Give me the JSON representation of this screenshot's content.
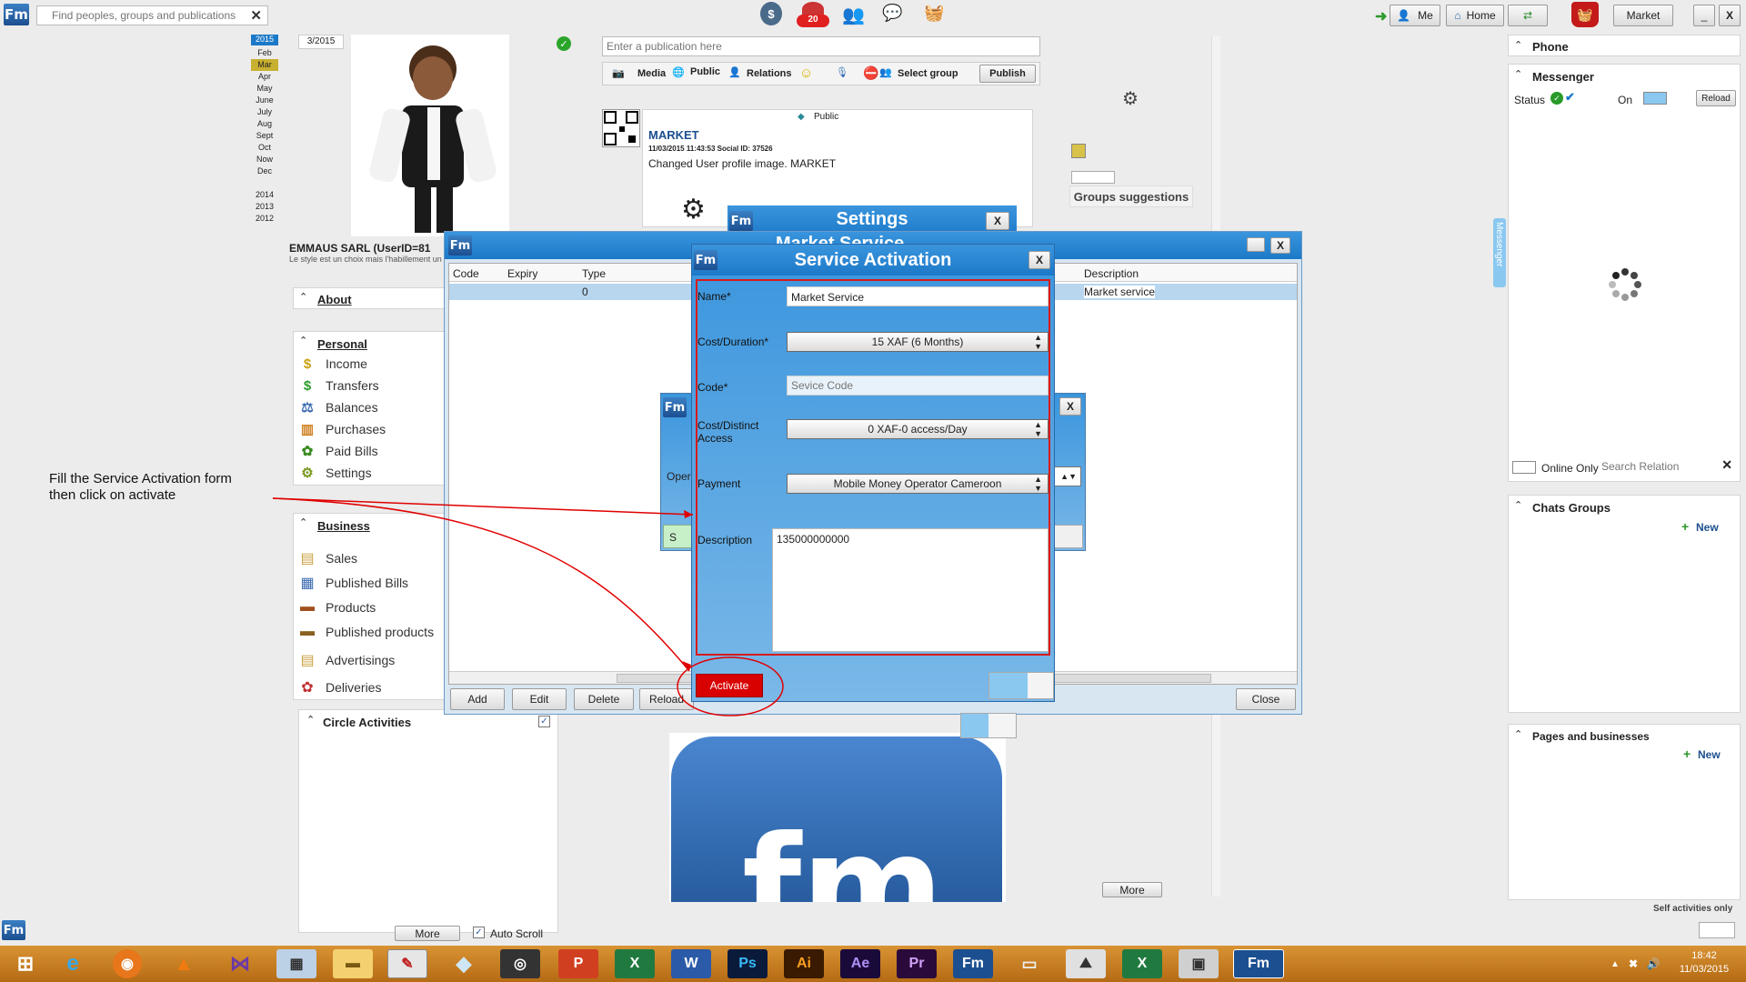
{
  "topbar": {
    "search_placeholder": "Find peoples, groups and publications",
    "notif_count": "20",
    "me_label": "Me",
    "home_label": "Home",
    "market_label": "Market",
    "minimize": "_",
    "close": "X"
  },
  "profile": {
    "year_current": "2015",
    "date_label": "3/2015",
    "months": [
      "Feb",
      "Mar",
      "Apr",
      "May",
      "June",
      "July",
      "Aug",
      "Sept",
      "Oct",
      "Now",
      "Dec"
    ],
    "active_month": "Mar",
    "years": [
      "2014",
      "2013",
      "2012"
    ],
    "name": "EMMAUS SARL (UserID=81",
    "slogan": "Le style est un choix mais l'habillement un"
  },
  "left_menu": {
    "about": "About",
    "personal": "Personal",
    "personal_items": [
      "Income",
      "Transfers",
      "Balances",
      "Purchases",
      "Paid Bills",
      "Settings"
    ],
    "business": "Business",
    "business_items": [
      "Sales",
      "Published Bills",
      "Products",
      "Published products",
      "Advertisings",
      "Deliveries"
    ],
    "circle": "Circle Activities",
    "more": "More",
    "auto_scroll": "Auto Scroll"
  },
  "annotation": {
    "line1": "Fill the Service Activation form",
    "line2": "then click on activate"
  },
  "publication": {
    "placeholder": "Enter a publication here",
    "media": "Media",
    "public": "Public",
    "relations": "Relations",
    "select_group": "Select group",
    "publish": "Publish",
    "post_visibility": "Public",
    "post_author": "MARKET",
    "post_meta": "11/03/2015 11:43:53   Social ID: 37526",
    "post_text": "Changed User profile image. MARKET",
    "groups_suggestions": "Groups suggestions",
    "more": "More"
  },
  "settings_window": {
    "title": "Settings",
    "subtitle": "Market Service"
  },
  "market_window": {
    "columns": [
      "Code",
      "Expiry",
      "Type",
      "Description"
    ],
    "row": {
      "type": "0",
      "description": "Market service"
    },
    "buttons": {
      "add": "Add",
      "edit": "Edit",
      "delete": "Delete",
      "reload": "Reload",
      "close": "Close"
    }
  },
  "back_dialog": {
    "oper_label": "Oper",
    "s_label": "S",
    "close": "X"
  },
  "activation": {
    "title": "Service Activation",
    "close": "X",
    "name_label": "Name*",
    "name_value": "Market Service",
    "cost_label": "Cost/Duration*",
    "cost_value": "15 XAF (6 Months)",
    "code_label": "Code*",
    "code_placeholder": "Sevice Code",
    "distinct_label": "Cost/Distinct Access",
    "distinct_value": "0 XAF-0 access/Day",
    "payment_label": "Payment",
    "payment_value": "Mobile Money Operator Cameroon",
    "description_label": "Description",
    "description_value": "135000000000",
    "activate": "Activate"
  },
  "right_panel": {
    "phone": "Phone",
    "messenger": "Messenger",
    "status": "Status",
    "on": "On",
    "reload": "Reload",
    "messenger_tab": "Messenger",
    "online_only": "Online Only",
    "search_placeholder": "Search Relation",
    "chats_groups": "Chats Groups",
    "new": "New",
    "pages": "Pages and businesses",
    "self_only": "Self activities only"
  },
  "taskbar": {
    "time": "18:42",
    "date": "11/03/2015"
  },
  "colors": {
    "accent_blue": "#1c79c8",
    "dialog_blue": "#2f8fdb",
    "activate_red": "#d90000",
    "annotation_red": "#e00000"
  }
}
